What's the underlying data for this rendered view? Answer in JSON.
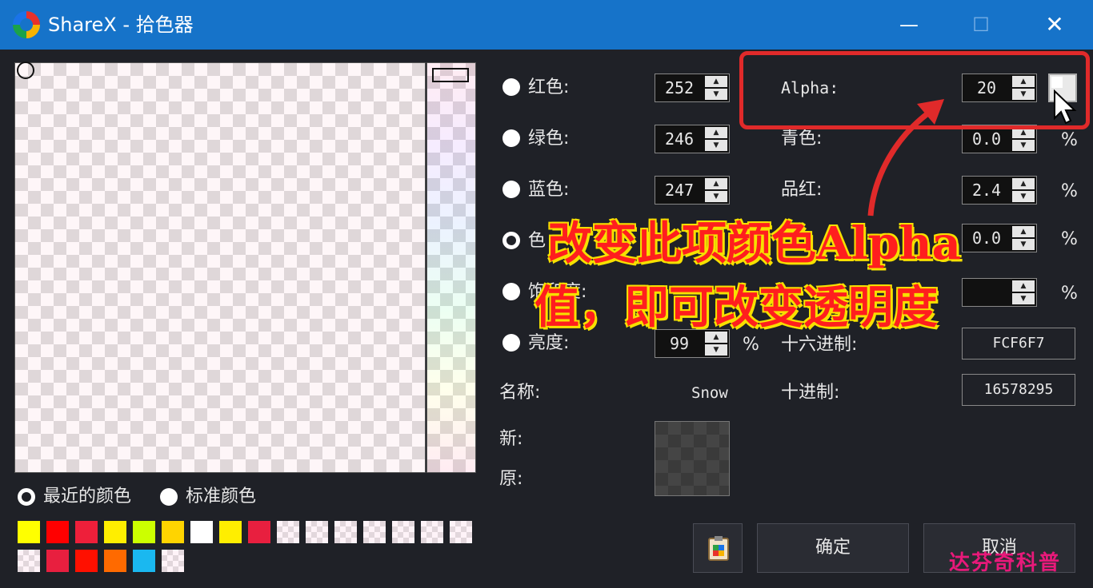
{
  "window": {
    "title": "ShareX - 拾色器",
    "minimize": "—",
    "maximize": "☐",
    "close": "✕"
  },
  "left_colors": [
    {
      "label": "红色:",
      "value": "252"
    },
    {
      "label": "绿色:",
      "value": "246"
    },
    {
      "label": "蓝色:",
      "value": "247"
    },
    {
      "label": "色"
    },
    {
      "label": "饱和度:"
    },
    {
      "label": "亮度:",
      "value": "99",
      "unit": "%"
    }
  ],
  "right_colors": [
    {
      "label": "Alpha:",
      "value": "20"
    },
    {
      "label": "青色:",
      "value": "0.0",
      "unit": "%"
    },
    {
      "label": "品红:",
      "value": "2.4",
      "unit": "%"
    },
    {
      "label": "",
      "value": "0.0",
      "unit": "%"
    },
    {
      "label": "",
      "value": "",
      "unit": "%"
    }
  ],
  "hex": {
    "label": "十六进制:",
    "value": "FCF6F7"
  },
  "decimal": {
    "label": "十进制:",
    "value": "16578295"
  },
  "name": {
    "label": "名称:",
    "value": "Snow"
  },
  "new_label": "新:",
  "old_label": "原:",
  "palette_tabs": {
    "recent": "最近的颜色",
    "standard": "标准颜色"
  },
  "swatches_row1": [
    "#ffff00",
    "#ff0000",
    "#ee1f3a",
    "#ffee00",
    "#ccff00",
    "#ffd400",
    "#ffffff",
    "#ffee00",
    "#e81f3f",
    "checker",
    "checker",
    "checker",
    "checker",
    "checker",
    "checker",
    "checker"
  ],
  "swatches_row2": [
    "checker",
    "#e81f3f",
    "#ff1000",
    "#ff6a00",
    "#1ab8f0",
    "checker"
  ],
  "buttons": {
    "ok": "确定",
    "cancel": "取消"
  },
  "annotation": {
    "line1": "改变此项颜色Alpha",
    "line2": "值，即可改变透明度"
  },
  "watermark": "达芬奇科普"
}
